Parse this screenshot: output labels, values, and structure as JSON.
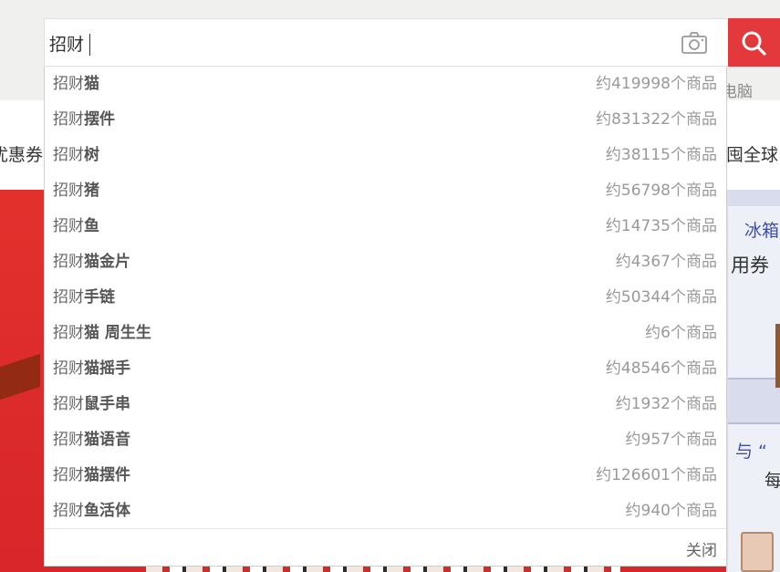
{
  "search": {
    "query": "招财",
    "camera_icon": "camera-icon",
    "button_icon": "search-icon",
    "accent": "#e4393c"
  },
  "background": {
    "left_text": "优惠券",
    "nav_fragment": "电脑",
    "right_text": "囤全球",
    "right_card1_title": "冰箱",
    "right_card1_sub": "用券",
    "right_card2_title": "与 “",
    "right_card2_sub": "每"
  },
  "suggestions": [
    {
      "prefix": "招财",
      "suffix": "猫",
      "count": "约419998个商品"
    },
    {
      "prefix": "招财",
      "suffix": "摆件",
      "count": "约831322个商品"
    },
    {
      "prefix": "招财",
      "suffix": "树",
      "count": "约38115个商品"
    },
    {
      "prefix": "招财",
      "suffix": "猪",
      "count": "约56798个商品"
    },
    {
      "prefix": "招财",
      "suffix": "鱼",
      "count": "约14735个商品"
    },
    {
      "prefix": "招财",
      "suffix": "猫金片",
      "count": "约4367个商品"
    },
    {
      "prefix": "招财",
      "suffix": "手链",
      "count": "约50344个商品"
    },
    {
      "prefix": "招财",
      "suffix": "猫 周生生",
      "count": "约6个商品"
    },
    {
      "prefix": "招财",
      "suffix": "猫摇手",
      "count": "约48546个商品"
    },
    {
      "prefix": "招财",
      "suffix": "鼠手串",
      "count": "约1932个商品"
    },
    {
      "prefix": "招财",
      "suffix": "猫语音",
      "count": "约957个商品"
    },
    {
      "prefix": "招财",
      "suffix": "猫摆件",
      "count": "约126601个商品"
    },
    {
      "prefix": "招财",
      "suffix": "鱼活体",
      "count": "约940个商品"
    }
  ],
  "dropdown": {
    "close_label": "关闭"
  }
}
